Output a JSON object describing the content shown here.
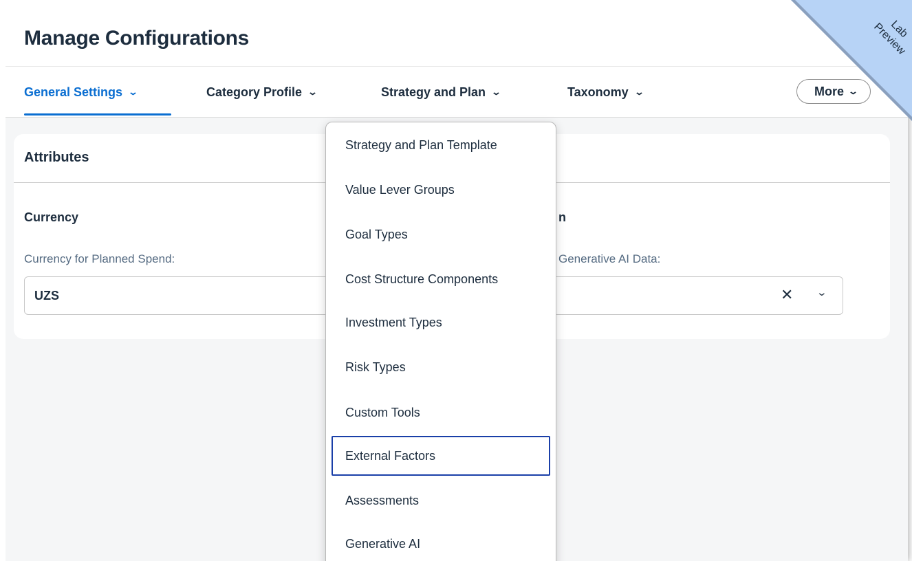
{
  "page": {
    "title": "Manage Configurations"
  },
  "tabs": [
    {
      "label": "General Settings",
      "active": true
    },
    {
      "label": "Category Profile",
      "active": false
    },
    {
      "label": "Strategy and Plan",
      "active": false
    },
    {
      "label": "Taxonomy",
      "active": false
    }
  ],
  "more_button": {
    "label": "More"
  },
  "card": {
    "title": "Attributes",
    "currency": {
      "section_title": "Currency",
      "field_label": "Currency for Planned Spend:",
      "value": "UZS"
    },
    "right_section": {
      "section_title_fragment": "n",
      "field_label_fragment": "Generative AI Data:"
    }
  },
  "dropdown": {
    "items": [
      "Strategy and Plan Template",
      "Value Lever Groups",
      "Goal Types",
      "Cost Structure Components",
      "Investment Types",
      "Risk Types",
      "Custom Tools",
      "External Factors",
      "Assessments",
      "Generative AI"
    ],
    "focused_item": "External Factors"
  },
  "ribbon": {
    "line1": "Lab",
    "line2": "Preview"
  },
  "icons": {
    "tab_chevron": "chevron-down-icon",
    "clear": "close-icon",
    "select": "chevron-down-icon"
  },
  "colors": {
    "accent": "#0a6ed1",
    "text": "#1d2d3e",
    "focus_border": "#1a3fa8",
    "ribbon": "#b7d3f6"
  }
}
